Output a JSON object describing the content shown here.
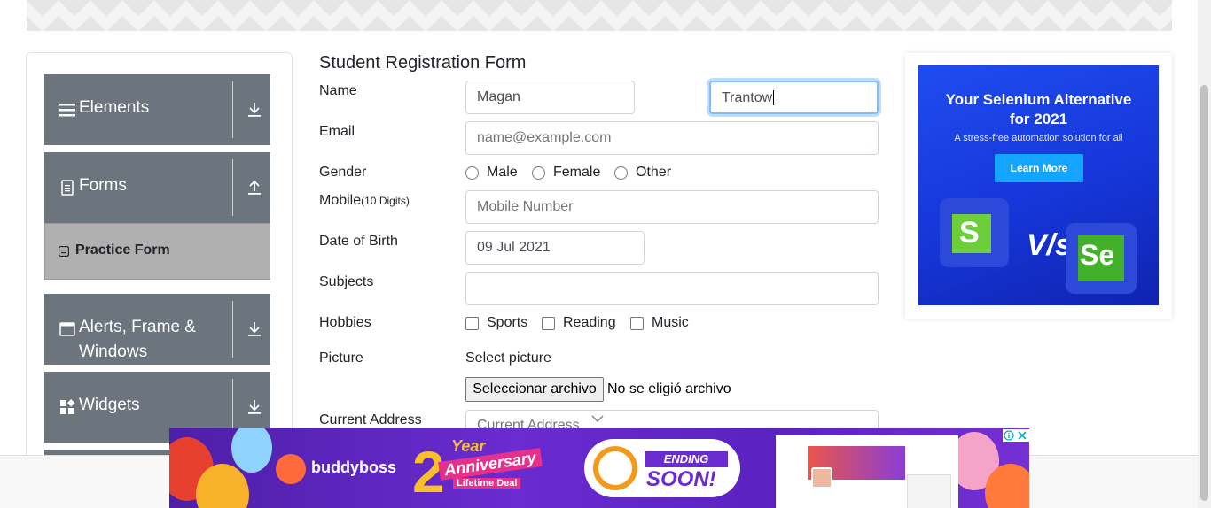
{
  "sidebar": {
    "groups": [
      {
        "label": "Elements",
        "icon": "menu-icon",
        "arrow": "download-arrow-icon"
      },
      {
        "label": "Forms",
        "icon": "document-icon",
        "arrow": "upload-arrow-icon"
      },
      {
        "label": "Alerts, Frame & Windows",
        "icon": "window-icon",
        "arrow": "download-arrow-icon"
      },
      {
        "label": "Widgets",
        "icon": "widgets-icon",
        "arrow": "download-arrow-icon"
      }
    ],
    "active_item": {
      "label": "Practice Form",
      "icon": "form-icon"
    }
  },
  "form": {
    "title": "Student Registration Form",
    "name_label": "Name",
    "first_name": "Magan",
    "last_name": "Trantow",
    "email_label": "Email",
    "email_placeholder": "name@example.com",
    "gender_label": "Gender",
    "gender_options": [
      "Male",
      "Female",
      "Other"
    ],
    "mobile_label": "Mobile",
    "mobile_hint": "(10 Digits)",
    "mobile_placeholder": "Mobile Number",
    "dob_label": "Date of Birth",
    "dob_value": "09 Jul 2021",
    "subjects_label": "Subjects",
    "subjects_value": "",
    "hobbies_label": "Hobbies",
    "hobby_options": [
      "Sports",
      "Reading",
      "Music"
    ],
    "picture_label": "Picture",
    "select_picture": "Select picture",
    "file_button": "Seleccionar archivo",
    "file_status": "No se eligió archivo",
    "address_label": "Current Address",
    "address_placeholder": "Current Address"
  },
  "side_ad": {
    "headline_1": "Your Selenium Alternative",
    "headline_2": "for 2021",
    "subtitle": "A stress-free automation solution for all",
    "cta": "Learn More",
    "vs": "V/s",
    "logo_left": "S",
    "logo_right": "Se",
    "accent": "#1f4cf0"
  },
  "bottom_ad": {
    "brand": "buddyboss",
    "anniv_year": "Year",
    "anniv_text": "Anniversary",
    "anniv_deal": "Lifetime Deal",
    "ending": "ENDING",
    "soon": "SOON!"
  }
}
